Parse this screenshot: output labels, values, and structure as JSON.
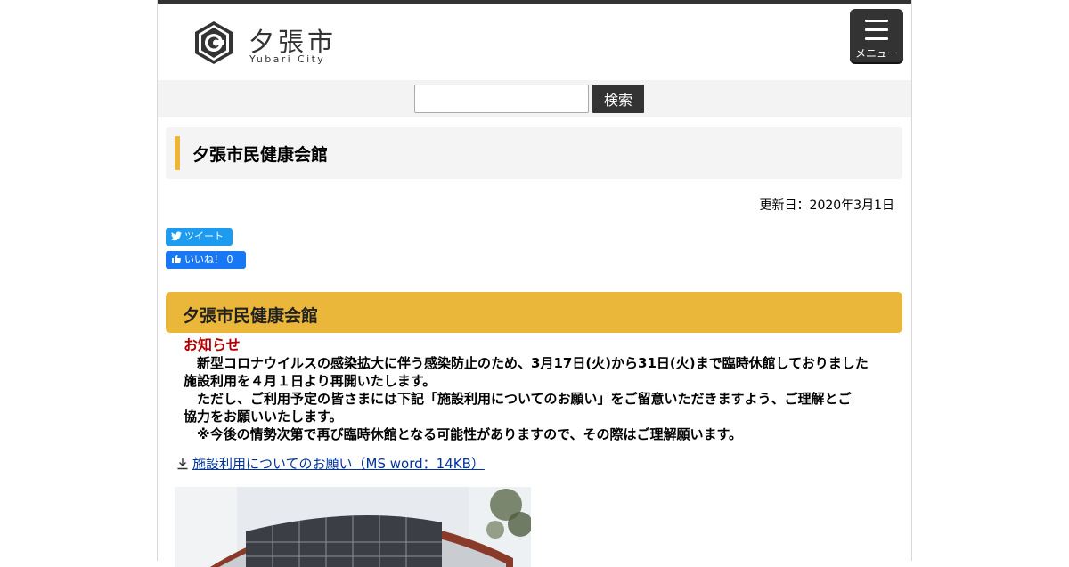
{
  "header": {
    "logo_jp": "夕張市",
    "logo_en": "Yubari City",
    "menu_label": "メニュー"
  },
  "search": {
    "value": "",
    "placeholder": "",
    "button_label": "検索"
  },
  "page": {
    "title": "夕張市民健康会館",
    "updated": "更新日：2020年3月1日"
  },
  "social": {
    "tweet_label": "ツイート",
    "like_label": "いいね！ 0"
  },
  "section": {
    "title": "夕張市民健康会館"
  },
  "notice": {
    "heading": "お知らせ",
    "lines": [
      "　新型コロナウイルスの感染拡大に伴う感染防止のため、3月17日(火)から31日(火)まで臨時休館しておりました",
      "施設利用を４月１日より再開いたします。",
      "　ただし、ご利用予定の皆さまには下記「施設利用についてのお願い」をご留意いただきますよう、ご理解とご",
      "協力をお願いいたします。",
      "　※今後の情勢次第で再び臨時休館となる可能性がありますので、その際はご理解願います。"
    ]
  },
  "download": {
    "icon": "download-icon",
    "link_text": "施設利用についてのお願い（MS word：14KB）"
  },
  "colors": {
    "accent": "#ebb73a",
    "dark": "#333333",
    "notice_red": "#b20000",
    "link": "#003399",
    "twitter": "#1d9bf0",
    "facebook": "#1877f2"
  }
}
